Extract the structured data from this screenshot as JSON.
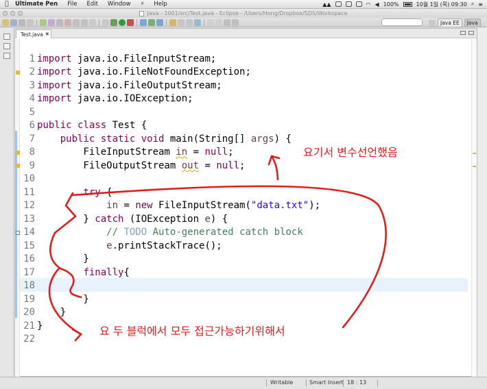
{
  "menubar": {
    "apple": "",
    "items": [
      "Ultimate Pen",
      "File",
      "Edit",
      "Window",
      "",
      "Help"
    ],
    "battery": "100%",
    "clock": "10월 1일 (목) 09:30"
  },
  "window": {
    "title": "Java - 1001/src/Test.java - Eclipse - /Users/Hong/Dropbox/SDS/Workspace"
  },
  "perspectives": [
    "Java EE",
    "Java"
  ],
  "editor": {
    "tab_label": "Test.java",
    "lines": [
      {
        "n": "1",
        "segs": [
          [
            "kw",
            "import"
          ],
          [
            "",
            "java.io.FileInputStream;"
          ]
        ],
        "gap": [
          0,
          1
        ]
      },
      {
        "n": "2",
        "segs": [
          [
            "kw",
            "import"
          ],
          [
            "",
            "java.io.FileNotFoundException;"
          ]
        ],
        "gap": [
          0,
          1
        ]
      },
      {
        "n": "3",
        "segs": [
          [
            "kw",
            "import"
          ],
          [
            "",
            "java.io.FileOutputStream;"
          ]
        ],
        "gap": [
          0,
          1
        ]
      },
      {
        "n": "4",
        "segs": [
          [
            "kw",
            "import"
          ],
          [
            "",
            "java.io.IOException;"
          ]
        ],
        "gap": [
          0,
          1
        ]
      },
      {
        "n": "5",
        "segs": []
      },
      {
        "n": "6",
        "segs": [
          [
            "kw",
            "public class"
          ],
          [
            "",
            "Test {"
          ]
        ],
        "gap": [
          0,
          1
        ]
      },
      {
        "n": "7",
        "segs": [
          [
            "",
            "    "
          ],
          [
            "kw",
            "public static void"
          ],
          [
            "",
            " main(String[] "
          ],
          [
            "var",
            "args"
          ],
          [
            "",
            " ) {"
          ]
        ]
      },
      {
        "n": "8",
        "segs": [
          [
            "",
            "        FileInputStream "
          ],
          [
            "var warn-ul",
            "in"
          ],
          [
            "",
            " = "
          ],
          [
            "kw",
            "null"
          ],
          [
            "",
            ";"
          ]
        ]
      },
      {
        "n": "9",
        "segs": [
          [
            "",
            "        FileOutputStream "
          ],
          [
            "var warn-ul",
            "out"
          ],
          [
            "",
            " = "
          ],
          [
            "kw",
            "null"
          ],
          [
            "",
            ";"
          ]
        ]
      },
      {
        "n": "10",
        "segs": []
      },
      {
        "n": "11",
        "segs": [
          [
            "",
            "        "
          ],
          [
            "kw",
            "try"
          ],
          [
            "",
            " {"
          ]
        ]
      },
      {
        "n": "12",
        "segs": [
          [
            "",
            "            "
          ],
          [
            "var",
            "in"
          ],
          [
            "",
            " = "
          ],
          [
            "kw",
            "new"
          ],
          [
            "",
            " FileInputStream("
          ],
          [
            "str",
            "\"data.txt\""
          ],
          [
            "",
            ");"
          ]
        ]
      },
      {
        "n": "13",
        "segs": [
          [
            "",
            "        } "
          ],
          [
            "kw",
            "catch"
          ],
          [
            "",
            " (IOException "
          ],
          [
            "var",
            "e"
          ],
          [
            "",
            ") {"
          ]
        ]
      },
      {
        "n": "14",
        "segs": [
          [
            "",
            "            "
          ],
          [
            "cm",
            "// "
          ],
          [
            "todo",
            "TODO"
          ],
          [
            "cm",
            " Auto-generated catch block"
          ]
        ]
      },
      {
        "n": "15",
        "segs": [
          [
            "",
            "            "
          ],
          [
            "var",
            "e"
          ],
          [
            "",
            ".printStackTrace();"
          ]
        ]
      },
      {
        "n": "16",
        "segs": [
          [
            "",
            "        }"
          ]
        ]
      },
      {
        "n": "17",
        "segs": [
          [
            "",
            "        "
          ],
          [
            "kw",
            "finally"
          ],
          [
            "",
            "{"
          ]
        ]
      },
      {
        "n": "18",
        "segs": []
      },
      {
        "n": "19",
        "segs": [
          [
            "",
            "        }"
          ]
        ]
      },
      {
        "n": "20",
        "segs": [
          [
            "",
            "    }"
          ]
        ]
      },
      {
        "n": "21",
        "segs": [
          [
            "",
            "}"
          ]
        ]
      },
      {
        "n": "22",
        "segs": []
      }
    ]
  },
  "annotations": {
    "note_top": "요기서 변수선언했음",
    "note_bottom": "요 두 블럭에서 모두 접근가능하기위해서",
    "color": "#e21b1b"
  },
  "status": {
    "mode": "Writable",
    "insert": "Smart Insert",
    "position": "18 : 13"
  }
}
